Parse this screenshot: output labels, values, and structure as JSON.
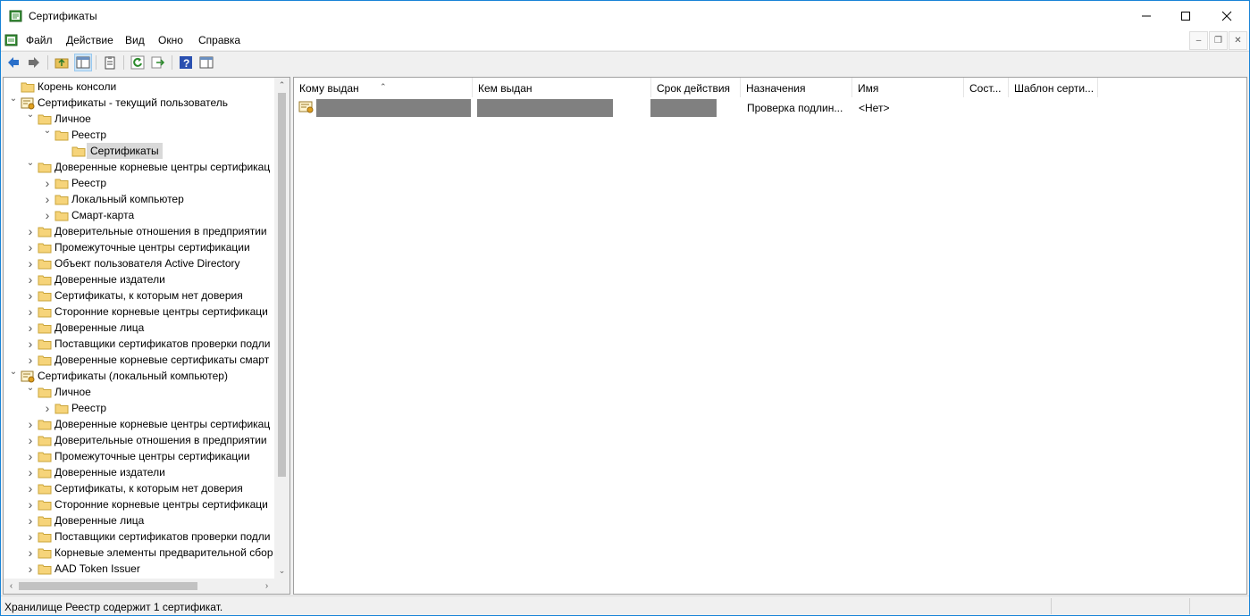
{
  "window": {
    "title": "Сертификаты"
  },
  "menu": [
    "Файл",
    "Действие",
    "Вид",
    "Окно",
    "Справка"
  ],
  "tree": [
    {
      "level": 0,
      "chev": "",
      "icon": "folder",
      "label": "Корень консоли"
    },
    {
      "level": 0,
      "chev": "v",
      "icon": "cert",
      "label": "Сертификаты - текущий пользователь"
    },
    {
      "level": 1,
      "chev": "v",
      "icon": "folder",
      "label": "Личное"
    },
    {
      "level": 2,
      "chev": "v",
      "icon": "folder",
      "label": "Реестр"
    },
    {
      "level": 3,
      "chev": "",
      "icon": "folder",
      "label": "Сертификаты",
      "selected": true
    },
    {
      "level": 1,
      "chev": "v",
      "icon": "folder",
      "label": "Доверенные корневые центры сертификац"
    },
    {
      "level": 2,
      "chev": ">",
      "icon": "folder",
      "label": "Реестр"
    },
    {
      "level": 2,
      "chev": ">",
      "icon": "folder",
      "label": "Локальный компьютер"
    },
    {
      "level": 2,
      "chev": ">",
      "icon": "folder",
      "label": "Смарт-карта"
    },
    {
      "level": 1,
      "chev": ">",
      "icon": "folder",
      "label": "Доверительные отношения в предприятии"
    },
    {
      "level": 1,
      "chev": ">",
      "icon": "folder",
      "label": "Промежуточные центры сертификации"
    },
    {
      "level": 1,
      "chev": ">",
      "icon": "folder",
      "label": "Объект пользователя Active Directory"
    },
    {
      "level": 1,
      "chev": ">",
      "icon": "folder",
      "label": "Доверенные издатели"
    },
    {
      "level": 1,
      "chev": ">",
      "icon": "folder",
      "label": "Сертификаты, к которым нет доверия"
    },
    {
      "level": 1,
      "chev": ">",
      "icon": "folder",
      "label": "Сторонние корневые центры сертификаци"
    },
    {
      "level": 1,
      "chev": ">",
      "icon": "folder",
      "label": "Доверенные лица"
    },
    {
      "level": 1,
      "chev": ">",
      "icon": "folder",
      "label": "Поставщики сертификатов проверки подли"
    },
    {
      "level": 1,
      "chev": ">",
      "icon": "folder",
      "label": "Доверенные корневые сертификаты смарт"
    },
    {
      "level": 0,
      "chev": "v",
      "icon": "cert",
      "label": "Сертификаты (локальный компьютер)"
    },
    {
      "level": 1,
      "chev": "v",
      "icon": "folder",
      "label": "Личное"
    },
    {
      "level": 2,
      "chev": ">",
      "icon": "folder",
      "label": "Реестр"
    },
    {
      "level": 1,
      "chev": ">",
      "icon": "folder",
      "label": "Доверенные корневые центры сертификац"
    },
    {
      "level": 1,
      "chev": ">",
      "icon": "folder",
      "label": "Доверительные отношения в предприятии"
    },
    {
      "level": 1,
      "chev": ">",
      "icon": "folder",
      "label": "Промежуточные центры сертификации"
    },
    {
      "level": 1,
      "chev": ">",
      "icon": "folder",
      "label": "Доверенные издатели"
    },
    {
      "level": 1,
      "chev": ">",
      "icon": "folder",
      "label": "Сертификаты, к которым нет доверия"
    },
    {
      "level": 1,
      "chev": ">",
      "icon": "folder",
      "label": "Сторонние корневые центры сертификаци"
    },
    {
      "level": 1,
      "chev": ">",
      "icon": "folder",
      "label": "Доверенные лица"
    },
    {
      "level": 1,
      "chev": ">",
      "icon": "folder",
      "label": "Поставщики сертификатов проверки подли"
    },
    {
      "level": 1,
      "chev": ">",
      "icon": "folder",
      "label": "Корневые элементы предварительной сбор"
    },
    {
      "level": 1,
      "chev": ">",
      "icon": "folder",
      "label": "AAD Token Issuer"
    }
  ],
  "list": {
    "columns": [
      "Кому выдан",
      "Кем выдан",
      "Срок действия",
      "Назначения",
      "Имя",
      "Сост...",
      "Шаблон серти..."
    ],
    "rows": [
      {
        "issued_to": "",
        "issued_by": "",
        "expires": "",
        "purposes": "Проверка подлин...",
        "name": "<Нет>",
        "status": "",
        "template": ""
      }
    ]
  },
  "status": {
    "text": "Хранилище Реестр содержит 1 сертификат."
  },
  "colors": {
    "window_border": "#1883d7",
    "selection": "#d9d9d9",
    "redaction": "#808080"
  }
}
